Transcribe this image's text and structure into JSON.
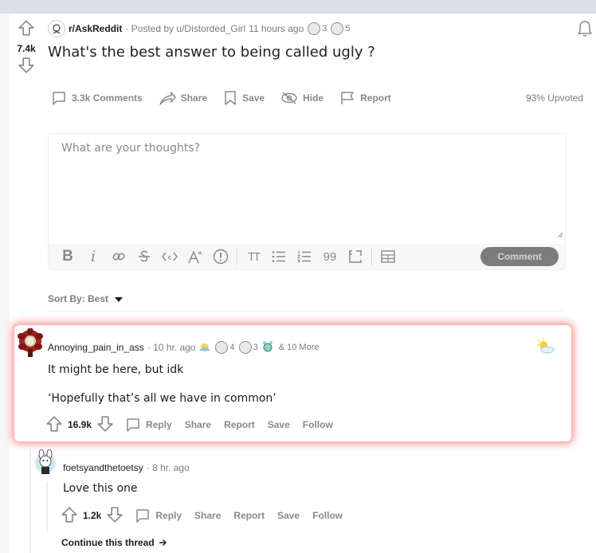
{
  "post": {
    "votes": "7.4k",
    "subreddit": "r/AskReddit",
    "posted_by": "· Posted by u/Distorded_Girl",
    "time": "11 hours ago",
    "award_counts": [
      "3",
      "5"
    ],
    "title": "What's the best answer to being called ugly ?",
    "actions": {
      "comments": "3.3k Comments",
      "share": "Share",
      "save": "Save",
      "hide": "Hide",
      "report": "Report"
    },
    "upvoted": "93% Upvoted"
  },
  "editor": {
    "placeholder": "What are your thoughts?",
    "toolbar": {
      "bold": "B",
      "italic": "i",
      "heading": "TT",
      "quote": "99"
    },
    "comment_button": "Comment"
  },
  "sort": {
    "label": "Sort By: Best"
  },
  "comments": [
    {
      "author": "Annoying_pain_in_ass",
      "time": "· 10 hr. ago",
      "award_counts": [
        "4",
        "3"
      ],
      "more_awards": "& 10 More",
      "body": [
        "It might be here, but idk",
        "‘Hopefully that’s all we have in common’"
      ],
      "score": "16.9k",
      "actions": {
        "reply": "Reply",
        "share": "Share",
        "report": "Report",
        "save": "Save",
        "follow": "Follow"
      }
    },
    {
      "author": "foetsyandthetoetsy",
      "time": "· 8 hr. ago",
      "body": [
        "Love this one"
      ],
      "score": "1.2k",
      "actions": {
        "reply": "Reply",
        "share": "Share",
        "report": "Report",
        "save": "Save",
        "follow": "Follow"
      },
      "continue_thread": "Continue this thread"
    }
  ],
  "colors": {
    "highlight_glow": "#ff6e6e",
    "muted_text": "#878a8c",
    "comment_button_bg": "#7c7c7c"
  }
}
